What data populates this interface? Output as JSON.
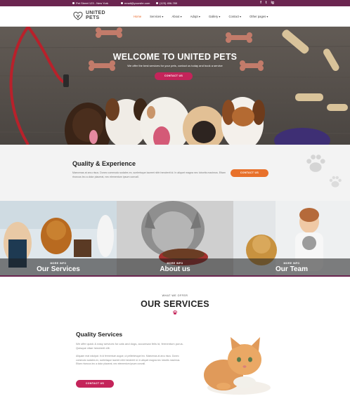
{
  "topbar": {
    "address": "Pet Street 123 - New York",
    "email": "email@yoursite.com",
    "phone": "(123) 456-789",
    "social": [
      "f",
      "t",
      "ig"
    ],
    "icons": [
      "location-icon",
      "mail-icon",
      "phone-icon",
      "facebook-icon",
      "twitter-icon",
      "instagram-icon"
    ]
  },
  "header": {
    "logo_line1": "UNITED",
    "logo_line2": "PETS",
    "nav": [
      {
        "label": "Home",
        "active": true
      },
      {
        "label": "Services ▾"
      },
      {
        "label": "About ▾"
      },
      {
        "label": "Adopt ▾"
      },
      {
        "label": "Gallery ▾"
      },
      {
        "label": "Contact ▾"
      },
      {
        "label": "Other pages ▾"
      }
    ]
  },
  "hero": {
    "title": "WELCOME TO UNITED PETS",
    "subtitle": "We offer the best services for your pets, contact us today and book a service",
    "button": "CONTACT US"
  },
  "quality": {
    "title": "Quality & Experience",
    "text": "Maecenas at arcu risus. Donec commodo sodales ex, scelerisque laoreet nibh hendrerit id. In aliquet magna nec lobortis maximus. Etiam rhoncus leo a dolor placerat, nec elementum ipsum convall.",
    "button": "CONTACT US"
  },
  "tiles": [
    {
      "more": "MORE INFO",
      "title": "Our Services"
    },
    {
      "more": "MORE INFO",
      "title": "About us"
    },
    {
      "more": "MORE INFO",
      "title": "Our Team"
    }
  ],
  "services": {
    "eyebrow": "WHAT WE OFFER",
    "title": "OUR SERVICES",
    "heading": "Quality Services",
    "lead": "We offer quick & easy services for cats and dogs, accumsan felis id, fermentum purus. Quisque vitae hendrerit elit.",
    "body": "Aliquam erat volutpat. In id fermentum augue, ut pellentesque leo. Maecenas at arcu risus. Donec commodo sodales ex, scelerisque laoreet nibh hendrerit id. In aliquet magna nec lobortis maximus. Etiam rhoncus leo a dolor placerat, nec elementum ipsum convall.",
    "button": "CONTACT US"
  },
  "colors": {
    "brand": "#6b2550",
    "accent": "#c4245a",
    "orange": "#e8712b"
  }
}
